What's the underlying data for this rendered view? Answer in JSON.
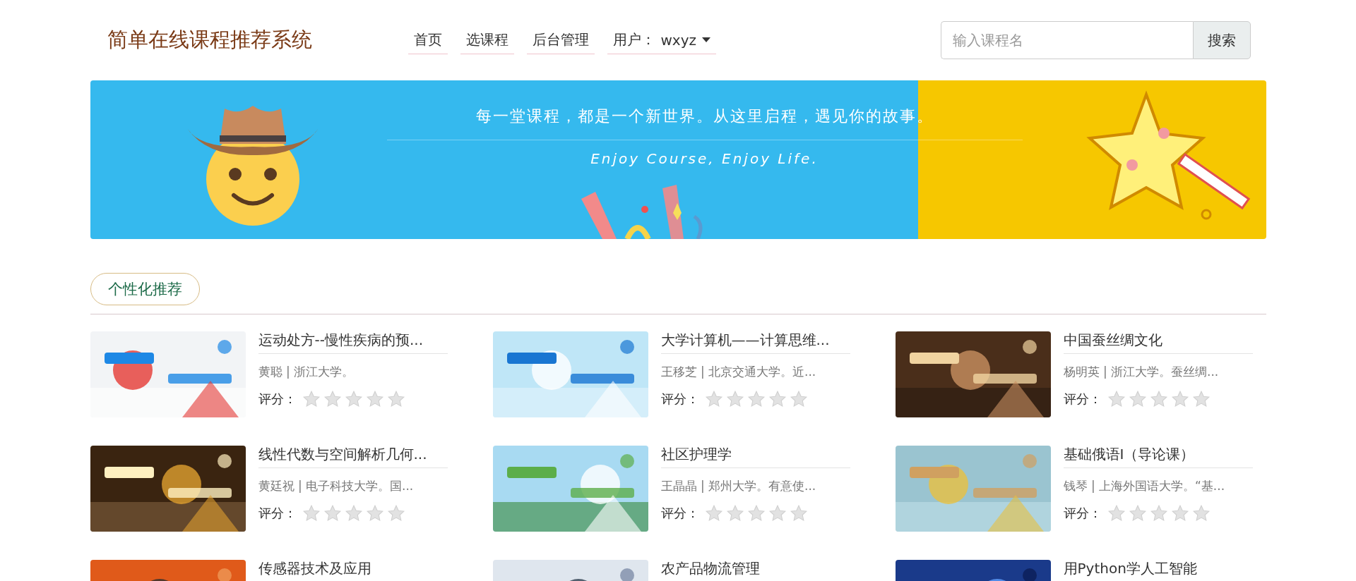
{
  "header": {
    "site_title": "简单在线课程推荐系统",
    "nav": [
      {
        "label": "首页"
      },
      {
        "label": "选课程"
      },
      {
        "label": "后台管理"
      }
    ],
    "user_menu": {
      "label": "用户：",
      "name": "wxyz"
    },
    "search": {
      "placeholder": "输入课程名",
      "button": "搜索"
    }
  },
  "banner": {
    "headline": "每一堂课程，都是一个新世界。从这里启程，遇见你的故事。",
    "tagline": "Enjoy Course, Enjoy Life."
  },
  "section": {
    "title": "个性化推荐"
  },
  "courses": [
    {
      "title": "运动处方--慢性疾病的预...",
      "meta": "黄聪 | 浙江大学。",
      "rating_label": "评分：",
      "stars": 0
    },
    {
      "title": "大学计算机——计算思维...",
      "meta": "王移芝 | 北京交通大学。近...",
      "rating_label": "评分：",
      "stars": 0
    },
    {
      "title": "中国蚕丝绸文化",
      "meta": "杨明英 | 浙江大学。蚕丝绸...",
      "rating_label": "评分：",
      "stars": 0
    },
    {
      "title": "线性代数与空间解析几何...",
      "meta": "黄廷祝 | 电子科技大学。国...",
      "rating_label": "评分：",
      "stars": 0
    },
    {
      "title": "社区护理学",
      "meta": "王晶晶 | 郑州大学。有意使...",
      "rating_label": "评分：",
      "stars": 0
    },
    {
      "title": "基础俄语Ⅰ（导论课）",
      "meta": "钱琴 | 上海外国语大学。“基...",
      "rating_label": "评分：",
      "stars": 0
    },
    {
      "title": "传感器技术及应用"
    },
    {
      "title": "农产品物流管理"
    },
    {
      "title": "用Python学人工智能"
    }
  ]
}
